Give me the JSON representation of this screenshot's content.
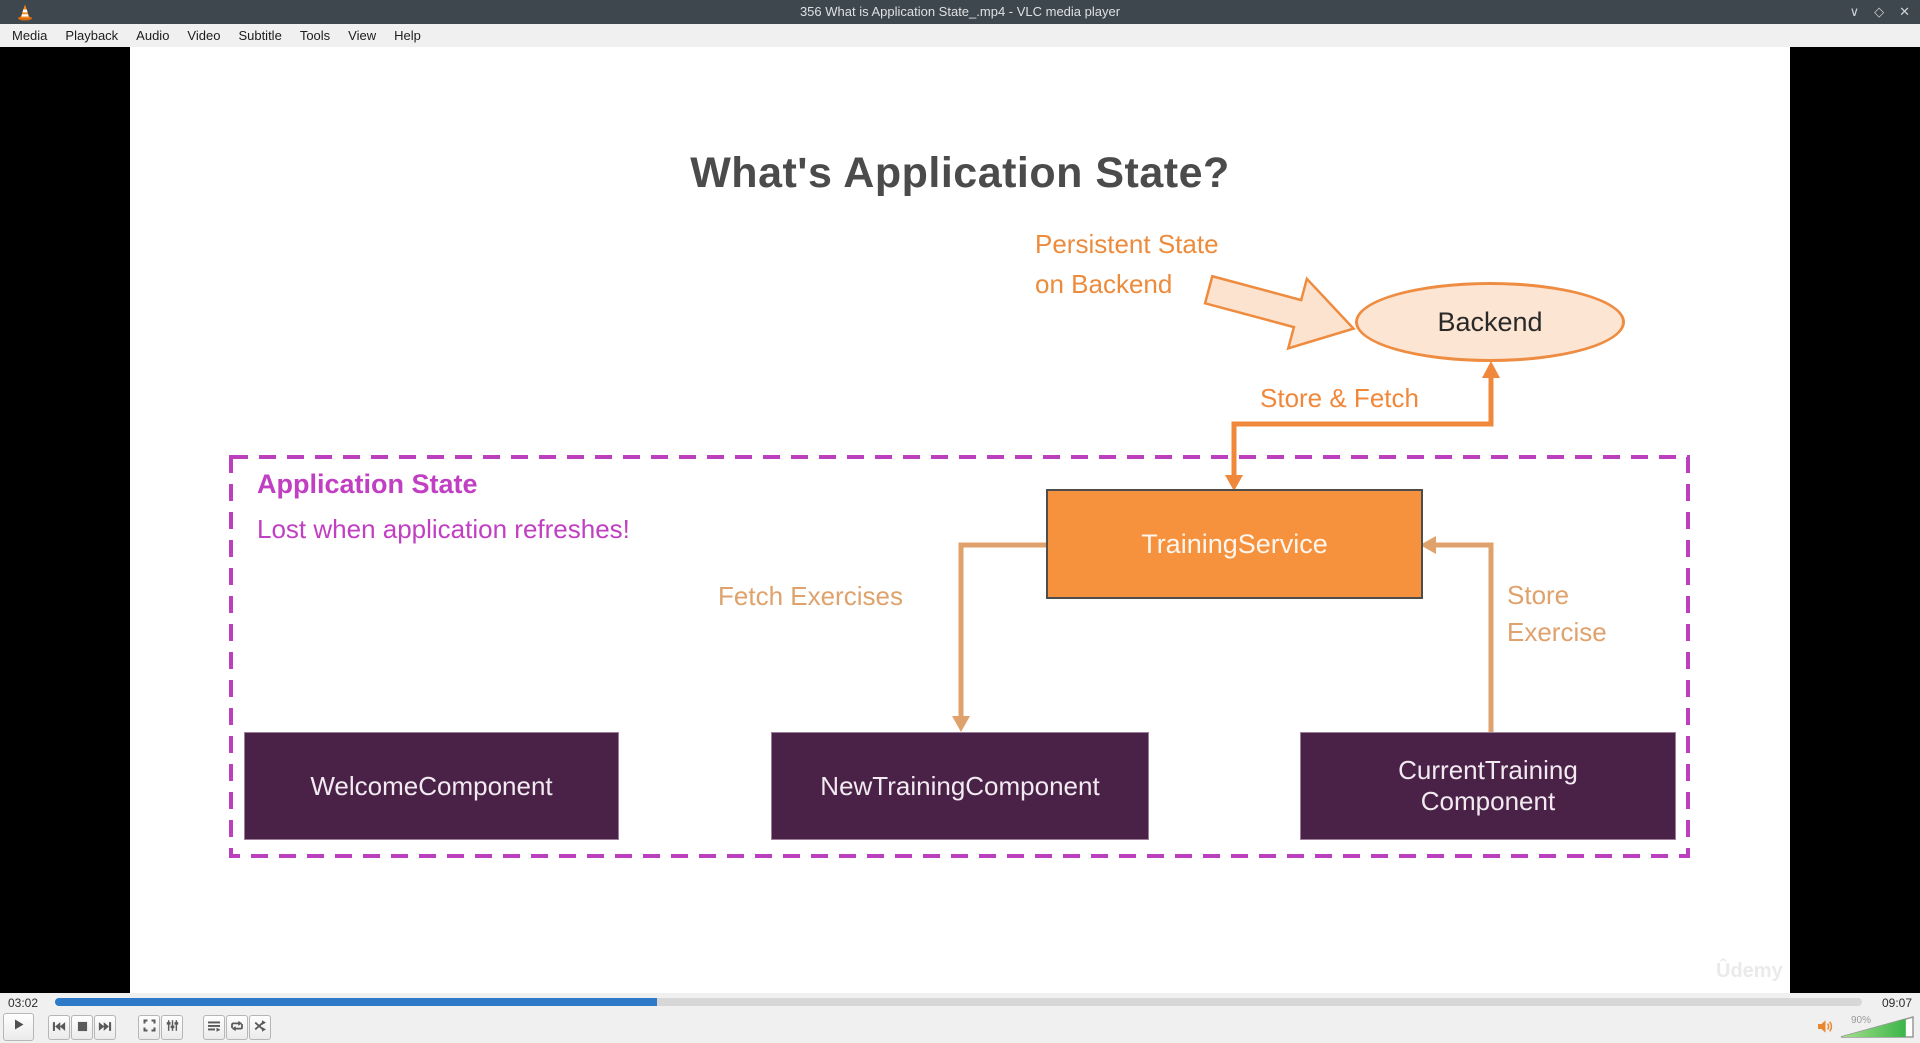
{
  "window": {
    "title": "356 What is Application State_.mp4 - VLC media player",
    "minimize_glyph": "∨",
    "maximize_glyph": "◇",
    "close_glyph": "✕"
  },
  "menu": {
    "items": [
      "Media",
      "Playback",
      "Audio",
      "Video",
      "Subtitle",
      "Tools",
      "View",
      "Help"
    ]
  },
  "slide": {
    "title": "What's Application State?",
    "persistent_label": "Persistent State\non Backend",
    "backend_label": "Backend",
    "store_fetch_label": "Store & Fetch",
    "app_state_title": "Application State",
    "app_state_subtitle": "Lost when application refreshes!",
    "training_service_label": "TrainingService",
    "fetch_exercises_label": "Fetch Exercises",
    "store_exercise_label": "Store\nExercise",
    "component_welcome": "WelcomeComponent",
    "component_new_training": "NewTrainingComponent",
    "component_current_training": "CurrentTraining\nComponent",
    "watermark": "Ûdemy",
    "colors": {
      "orange_accent": "#f0883b",
      "tan_accent": "#dfa26c",
      "magenta_accent": "#c03fc2",
      "orange_box_fill": "#f6923e",
      "peach_fill": "#fce5d2",
      "purple_box_fill": "#4a2147",
      "title_text": "#4b4b4b"
    }
  },
  "player": {
    "elapsed": "03:02",
    "total": "09:07",
    "progress_pct": 33.3,
    "volume_pct": 90,
    "volume_label": "90%",
    "seek_fill_color": "#2c7ac8",
    "volume_fill_color": "#3cb54a",
    "button_icons": [
      "play-icon",
      "previous-icon",
      "stop-icon",
      "next-icon",
      "fullscreen-icon",
      "extended-settings-icon",
      "playlist-icon",
      "loop-icon",
      "random-icon",
      "volume-icon"
    ]
  }
}
